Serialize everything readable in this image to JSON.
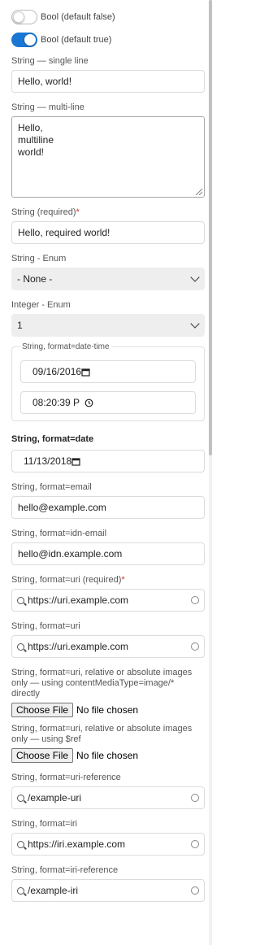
{
  "toggles": [
    {
      "label": "Bool (default false)",
      "on": false
    },
    {
      "label": "Bool (default true)",
      "on": true
    }
  ],
  "string_single": {
    "label": "String — single line",
    "value": "Hello, world!"
  },
  "string_multi": {
    "label": "String — multi-line",
    "lines": [
      "Hello,",
      "multiline",
      "world!"
    ]
  },
  "string_required": {
    "label": "String (required)",
    "required_mark": "*",
    "value": "Hello, required world!"
  },
  "string_enum": {
    "label": "String - Enum",
    "selected": "- None -"
  },
  "integer_enum": {
    "label": "Integer - Enum",
    "selected": "1"
  },
  "datetime": {
    "legend": "String, format=date-time",
    "date": "09/16/2016",
    "time": "08:20:39 P"
  },
  "date_field": {
    "label": "String, format=date",
    "value": "11/13/2018"
  },
  "email": {
    "label": "String, format=email",
    "value": "hello@example.com"
  },
  "idn_email": {
    "label": "String, format=idn-email",
    "value": "hello@idn.example.com"
  },
  "uri_required": {
    "label": "String, format=uri (required)",
    "required_mark": "*",
    "value": "https://uri.example.com"
  },
  "uri": {
    "label": "String, format=uri",
    "value": "https://uri.example.com"
  },
  "file_media": {
    "label": "String, format=uri, relative or absolute images only — using contentMediaType=image/* directly",
    "button": "Choose File",
    "status": "No file chosen"
  },
  "file_ref": {
    "label": "String, format=uri, relative or absolute images only — using $ref",
    "button": "Choose File",
    "status": "No file chosen"
  },
  "uri_reference": {
    "label": "String, format=uri-reference",
    "value": "/example-uri"
  },
  "iri": {
    "label": "String, format=iri",
    "value": "https://iri.example.com"
  },
  "iri_reference": {
    "label": "String, format=iri-reference",
    "value": "/example-iri"
  },
  "colors": {
    "accent": "#1976d2",
    "required": "#d32f2f",
    "select_bg": "#eeeeee"
  }
}
